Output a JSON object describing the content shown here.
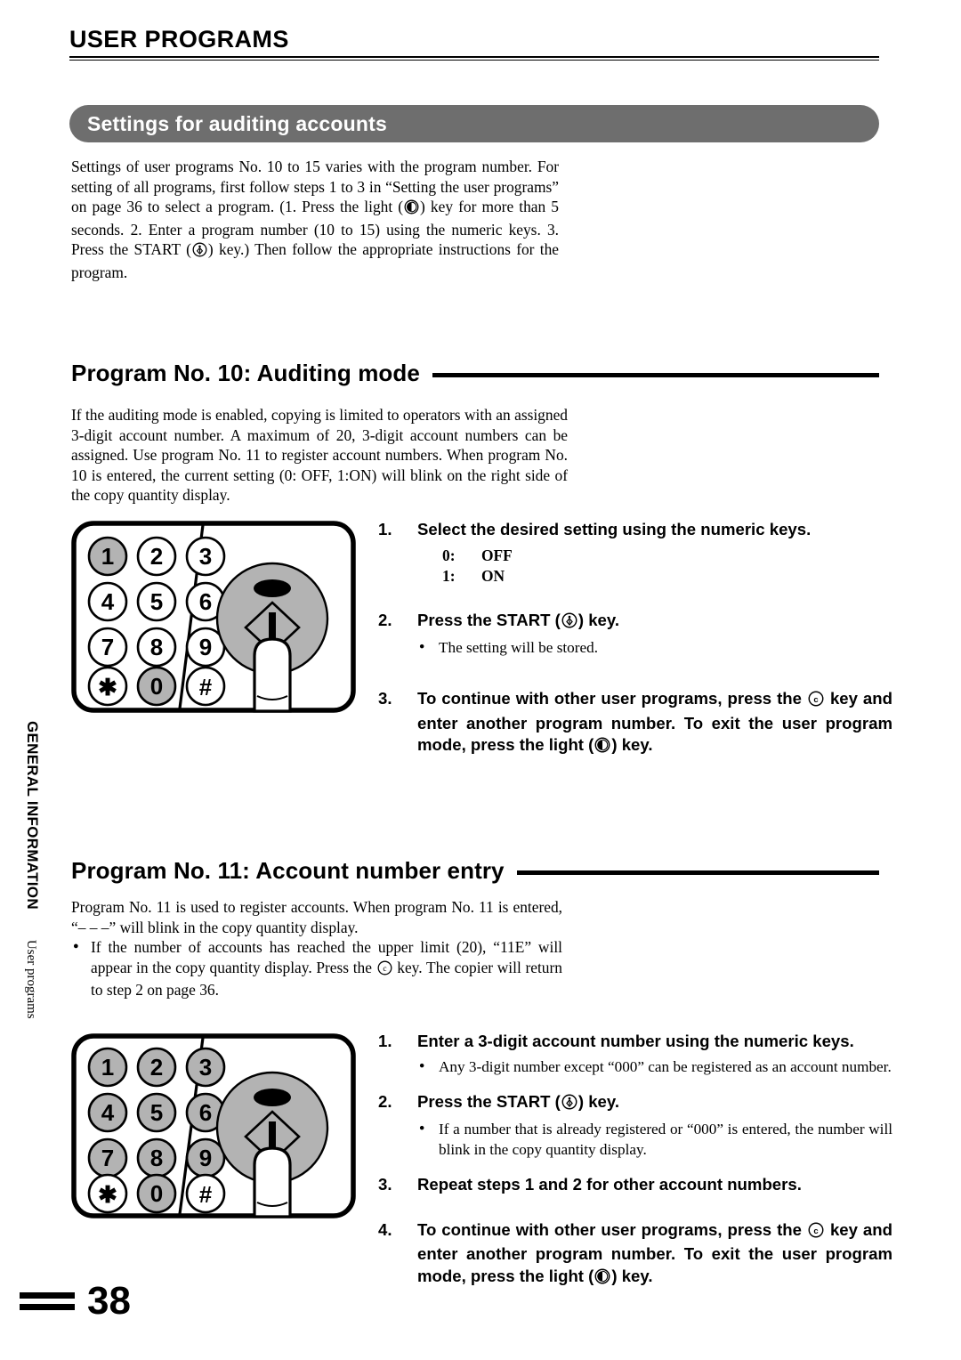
{
  "page": {
    "running_head": "USER PROGRAMS",
    "folio_number": "38",
    "side_tab_main": "GENERAL INFORMATION",
    "side_tab_sub": "User programs",
    "banner_color": "#6e6e6e",
    "key_fill_color": "#b3b3b3"
  },
  "banner": {
    "title": "Settings for auditing accounts"
  },
  "intro": {
    "text_a": "Settings of user programs No. 10 to 15 varies with the program number. For setting of all programs, first follow steps 1 to 3 in “Setting the user programs” on page 36 to select a program. (1. Press the light (",
    "text_b": ") key for more than 5 seconds. 2. Enter a program number (10 to 15) using the numeric keys. 3. Press the START (",
    "text_c": ") key.) Then follow the appropriate instructions for the program."
  },
  "section10": {
    "heading": "Program No. 10: Auditing mode",
    "paragraph": "If the auditing mode is enabled, copying is limited to operators with an assigned 3-digit account number. A maximum of 20, 3-digit account numbers can be assigned. Use program No. 11 to register account numbers. When program No. 10 is entered, the current setting (0: OFF, 1:ON) will blink on the right side of the copy quantity display.",
    "keypad": {
      "keys": [
        "1",
        "2",
        "3",
        "4",
        "5",
        "6",
        "7",
        "8",
        "9",
        "✱",
        "0",
        "#"
      ],
      "highlighted": [
        "1",
        "0"
      ]
    },
    "steps": [
      {
        "num": "1.",
        "text": "Select the desired setting using the numeric keys.",
        "options": [
          {
            "key": "0:",
            "value": "OFF"
          },
          {
            "key": "1:",
            "value": "ON"
          }
        ]
      },
      {
        "num": "2.",
        "text_a": "Press the START (",
        "text_b": ") key.",
        "note": "The setting will be stored."
      },
      {
        "num": "3.",
        "text_a": "To continue with other user programs, press the ",
        "text_b": " key and enter another program number. To exit the user program mode, press the light (",
        "text_c": ") key."
      }
    ]
  },
  "section11": {
    "heading": "Program No. 11: Account number entry",
    "paragraph": "Program No. 11 is used to register accounts. When program No. 11 is entered, “– – –” will blink in the copy quantity display.",
    "bullet_a": "If the number of accounts has reached the upper limit (20), “11E” will appear in the copy quantity display. Press the ",
    "bullet_b": " key. The copier will return to step 2 on page 36.",
    "keypad": {
      "keys": [
        "1",
        "2",
        "3",
        "4",
        "5",
        "6",
        "7",
        "8",
        "9",
        "✱",
        "0",
        "#"
      ],
      "highlighted": [
        "1",
        "2",
        "3",
        "4",
        "5",
        "6",
        "7",
        "8",
        "9",
        "0"
      ]
    },
    "steps": [
      {
        "num": "1.",
        "text": "Enter a 3-digit account number using the numeric keys.",
        "note": "Any 3-digit number except “000” can be registered as an account number."
      },
      {
        "num": "2.",
        "text_a": "Press the START (",
        "text_b": ") key.",
        "note": "If a number that is already registered or “000” is entered, the number will blink in the copy quantity display."
      },
      {
        "num": "3.",
        "text": "Repeat steps 1 and 2 for other account numbers."
      },
      {
        "num": "4.",
        "text_a": "To continue with other user programs, press the ",
        "text_b": " key and enter another program number. To exit the user program mode, press the light (",
        "text_c": ") key."
      }
    ]
  },
  "icons": {
    "light_key": "light-key-icon",
    "start_key": "start-key-icon",
    "clear_key": "clear-key-icon"
  }
}
